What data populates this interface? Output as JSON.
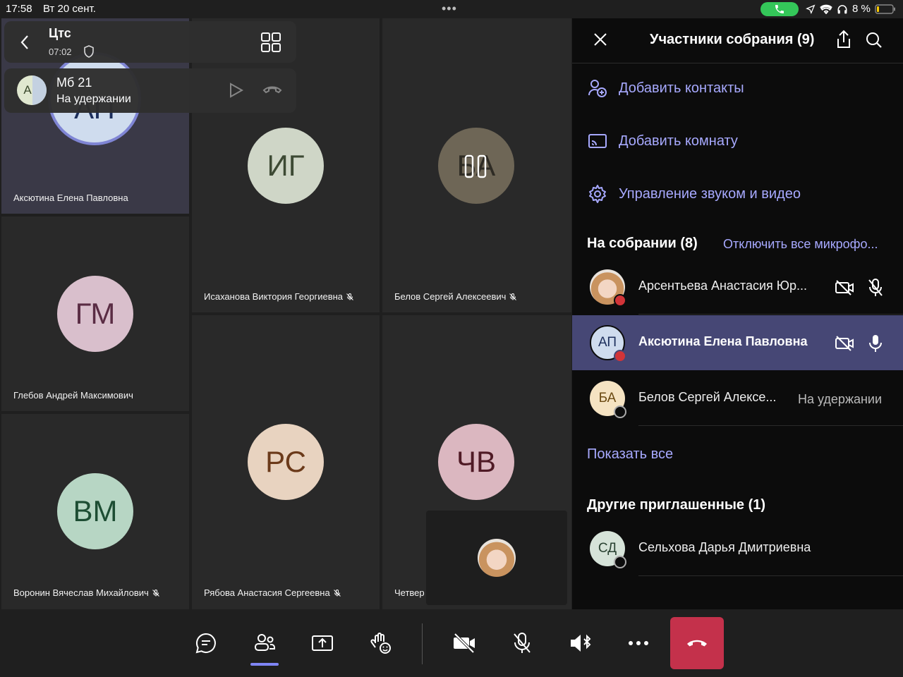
{
  "status": {
    "time": "17:58",
    "date": "Вт 20 сент.",
    "dots": "•••",
    "battery": "8 %"
  },
  "meeting": {
    "title": "Цтс",
    "duration": "07:02"
  },
  "hold_call": {
    "avatar": "А",
    "name": "Мб 21",
    "status": "На удержании"
  },
  "tiles": [
    {
      "initials": "АП",
      "name": "Аксютина Елена Павловна"
    },
    {
      "initials": "ИГ",
      "name": "Исаханова Виктория Георгиевна"
    },
    {
      "initials": "БА",
      "name": "Белов Сергей Алексеевич"
    },
    {
      "initials": "ГМ",
      "name": "Глебов Андрей Максимович"
    },
    {
      "initials": "ВМ",
      "name": "Воронин Вячеслав Михайлович"
    },
    {
      "initials": "РС",
      "name": "Рябова Анастасия Сергеевна"
    },
    {
      "initials": "ЧВ",
      "name": "Четвер"
    }
  ],
  "panel": {
    "title": "Участники собрания (9)",
    "actions": [
      "Добавить контакты",
      "Добавить комнату",
      "Управление звуком и видео"
    ],
    "in_meeting_header": "На собрании (8)",
    "mute_all": "Отключить все микрофо...",
    "participants": [
      {
        "initials": "",
        "name": "Арсентьева Анастасия Юр..."
      },
      {
        "initials": "АП",
        "name": "Аксютина Елена Павловна"
      },
      {
        "initials": "БА",
        "name": "Белов Сергей Алексе...",
        "status": "На удержании"
      }
    ],
    "show_all": "Показать все",
    "others_header": "Другие приглашенные (1)",
    "others": [
      {
        "initials": "СД",
        "name": "Сельхова Дарья Дмитриевна"
      }
    ]
  },
  "colors": {
    "accent": "#a7a9ff",
    "hangup": "#c4314b",
    "selected_row": "#464775"
  }
}
